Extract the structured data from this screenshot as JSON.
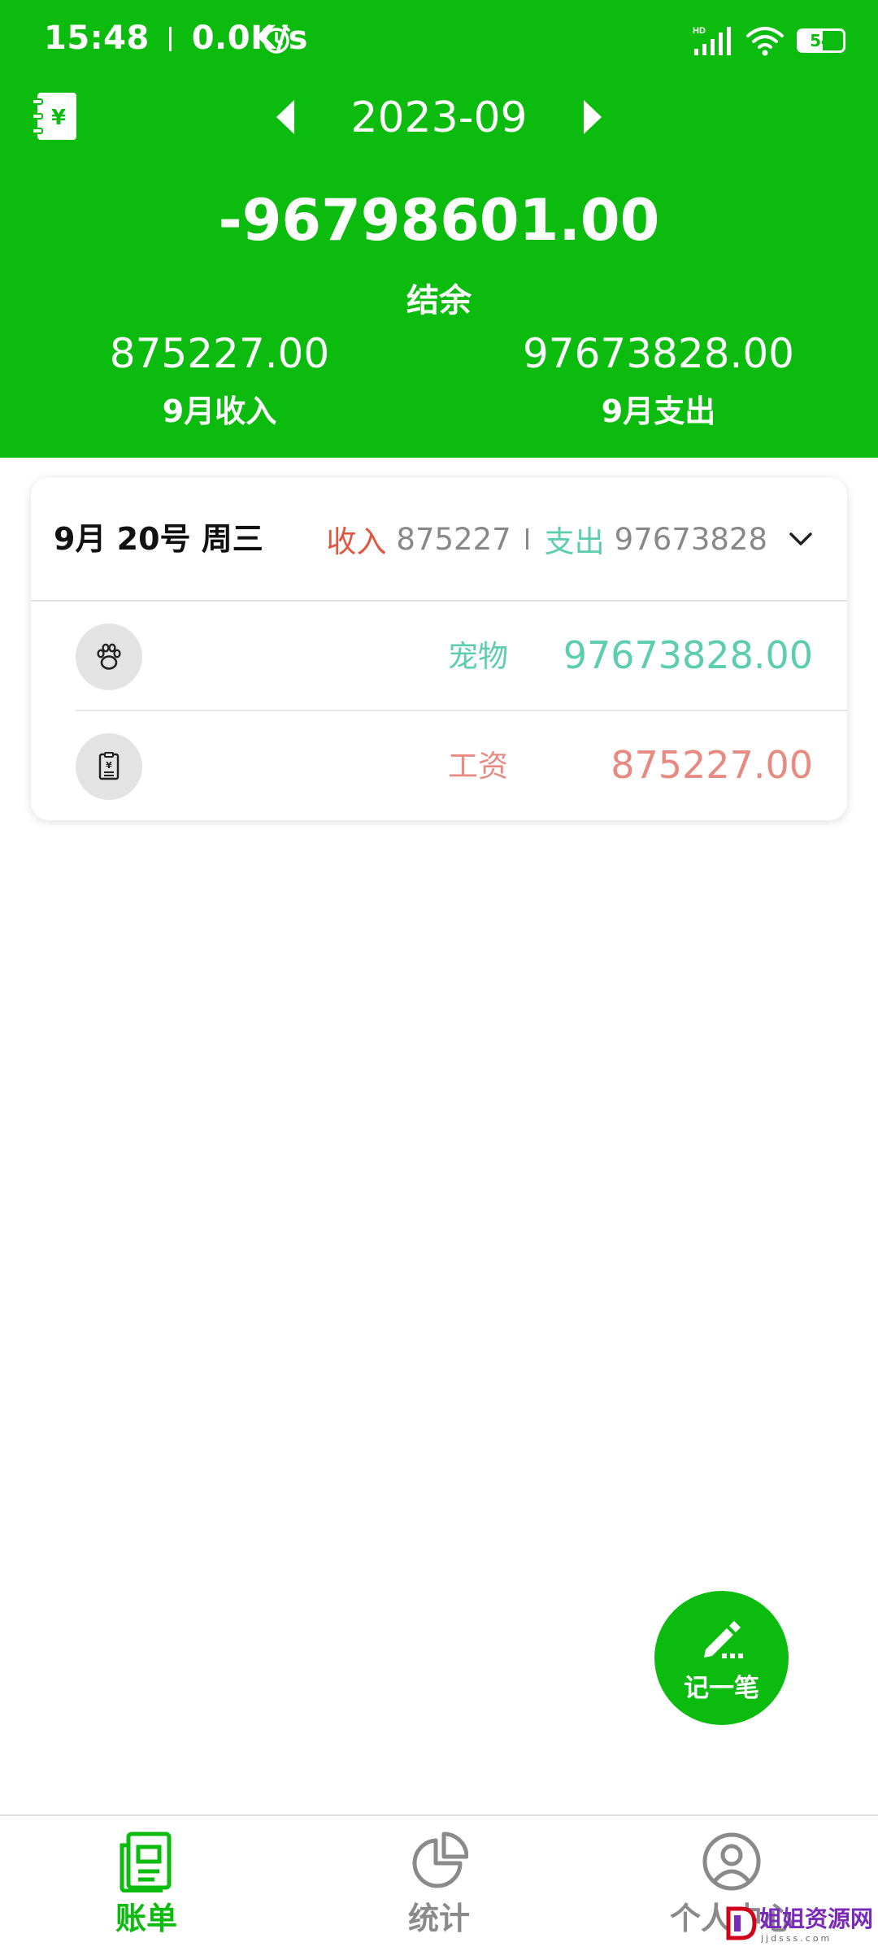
{
  "status_bar": {
    "time": "15:48",
    "network_speed": "0.0K/s",
    "network_type": "HD",
    "battery": "54",
    "battery_level_percent": 54,
    "icons": [
      "alarm-icon",
      "cellular-signal-icon",
      "wifi-icon",
      "battery-icon"
    ]
  },
  "header": {
    "month": "2023-09",
    "balance": "-96798601.00",
    "balance_label": "结余",
    "income_value": "875227.00",
    "income_label": "9月收入",
    "expense_value": "97673828.00",
    "expense_label": "9月支出",
    "icons": [
      "ledger-book-icon",
      "triangle-left-icon",
      "triangle-right-icon"
    ]
  },
  "day_card": {
    "date": "9月 20号 周三",
    "income_label": "收入",
    "income_amount": "875227",
    "expense_label": "支出",
    "expense_amount": "97673828",
    "records": [
      {
        "category": "宠物",
        "amount": "97673828.00",
        "icon": "paw-icon",
        "type": "expense"
      },
      {
        "category": "工资",
        "amount": "875227.00",
        "icon": "salary-slip-icon",
        "type": "income"
      }
    ]
  },
  "fab": {
    "label": "记一笔",
    "icon": "pencil-icon"
  },
  "bottom_nav": {
    "items": [
      {
        "label": "账单",
        "icon": "bill-icon",
        "active": true
      },
      {
        "label": "统计",
        "icon": "pie-chart-icon",
        "active": false
      },
      {
        "label": "个人中心",
        "icon": "user-icon",
        "active": false
      }
    ]
  },
  "watermark": {
    "text": "姐姐资源网",
    "sub": "jjdsss.com"
  },
  "colors": {
    "primary_green": "#0bbb0e",
    "income_red": "#e2563f",
    "expense_teal": "#5ccdaf",
    "income_amount_salmon": "#e78a82",
    "muted_gray": "#888888"
  }
}
